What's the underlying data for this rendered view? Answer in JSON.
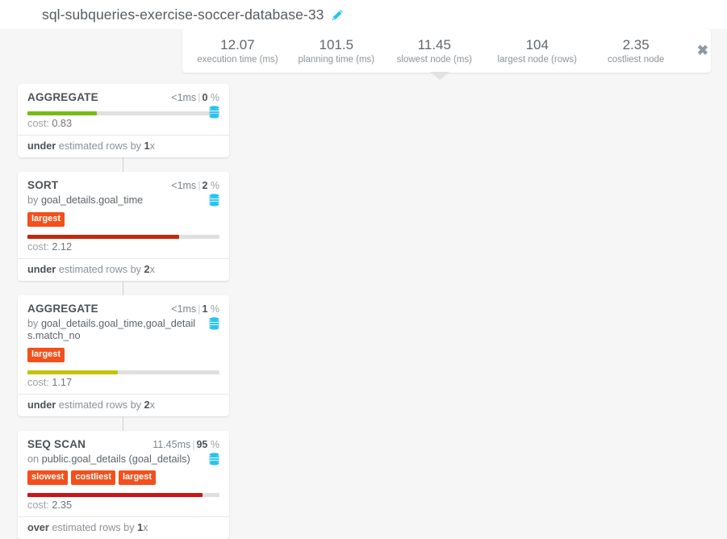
{
  "header": {
    "plan_title": "sql-subqueries-exercise-soccer-database-33",
    "edit_icon": "pencil-icon"
  },
  "stats": {
    "close_icon": "close-icon",
    "close_label": "✖",
    "items": [
      {
        "value": "12.07",
        "label": "execution time (ms)"
      },
      {
        "value": "101.5",
        "label": "planning time (ms)"
      },
      {
        "value": "11.45",
        "label": "slowest node (ms)"
      },
      {
        "value": "104",
        "label": "largest node (rows)"
      },
      {
        "value": "2.35",
        "label": "costliest node"
      }
    ]
  },
  "colors": {
    "badge": "#f3501c",
    "bar_green": "#74bc16",
    "bar_olive": "#c3c304",
    "bar_darkred": "#c02a0c",
    "bar_red": "#cf1212",
    "icon_cyan": "#29c3f0",
    "background": "#f6f6f6"
  },
  "plan_nodes": [
    {
      "type": "AGGREGATE",
      "duration": "<1ms",
      "separator": "|",
      "percent": "0",
      "percent_sign": "%",
      "detail_prefix": "",
      "detail": "",
      "badges": [],
      "bar_percent": 36,
      "bar_color": "#74bc16",
      "cost_label": "cost:",
      "cost_value": "0.83",
      "estimate_word": "under",
      "estimate_rest": " estimated rows by ",
      "estimate_factor": "1",
      "estimate_suffix": "x",
      "db_icon": "database-icon"
    },
    {
      "type": "SORT",
      "duration": "<1ms",
      "separator": "|",
      "percent": "2",
      "percent_sign": "%",
      "detail_prefix": "by ",
      "detail": "goal_details.goal_time",
      "badges": [
        "largest"
      ],
      "bar_percent": 79,
      "bar_color": "#c02a0c",
      "cost_label": "cost:",
      "cost_value": "2.12",
      "estimate_word": "under",
      "estimate_rest": " estimated rows by ",
      "estimate_factor": "2",
      "estimate_suffix": "x",
      "db_icon": "database-icon"
    },
    {
      "type": "AGGREGATE",
      "duration": "<1ms",
      "separator": "|",
      "percent": "1",
      "percent_sign": "%",
      "detail_prefix": "by ",
      "detail": "goal_details.goal_time,goal_details.match_no",
      "badges": [
        "largest"
      ],
      "bar_percent": 47,
      "bar_color": "#c3c304",
      "cost_label": "cost:",
      "cost_value": "1.17",
      "estimate_word": "under",
      "estimate_rest": " estimated rows by ",
      "estimate_factor": "2",
      "estimate_suffix": "x",
      "db_icon": "database-icon"
    },
    {
      "type": "SEQ SCAN",
      "duration": "11.45ms",
      "separator": "|",
      "percent": "95",
      "percent_sign": "%",
      "detail_prefix": "on ",
      "detail": "public.goal_details (goal_details)",
      "badges": [
        "slowest",
        "costliest",
        "largest"
      ],
      "bar_percent": 91,
      "bar_color": "#cf1212",
      "cost_label": "cost:",
      "cost_value": "2.35",
      "estimate_word": "over",
      "estimate_rest": " estimated rows by ",
      "estimate_factor": "1",
      "estimate_suffix": "x",
      "db_icon": "database-icon"
    }
  ]
}
